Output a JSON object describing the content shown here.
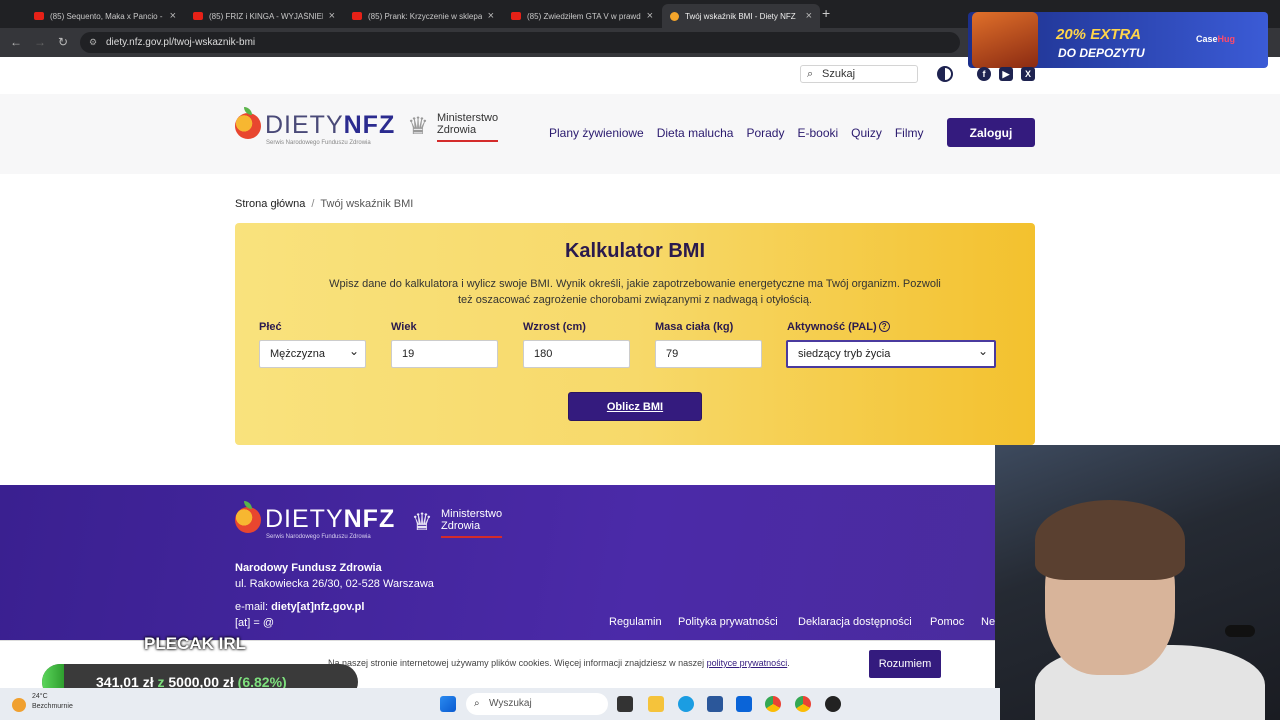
{
  "browser": {
    "tabs": [
      {
        "title": "(85) Sequento, Maka x Pancio -",
        "type": "youtube"
      },
      {
        "title": "(85) FRIZ i KINGA - WYJAŚNIEN",
        "type": "youtube"
      },
      {
        "title": "(85) Prank: Krzyczenie w sklepa",
        "type": "youtube"
      },
      {
        "title": "(85) Zwiedziłem GTA V w prawd",
        "type": "youtube"
      },
      {
        "title": "Twój wskaźnik BMI - Diety NFZ",
        "type": "active"
      }
    ],
    "url": "diety.nfz.gov.pl/twoj-wskaznik-bmi"
  },
  "ad": {
    "line1": "20% EXTRA",
    "line2": "DO DEPOZYTU",
    "brand_a": "Case",
    "brand_b": "Hug"
  },
  "utility": {
    "search_placeholder": "Szukaj"
  },
  "header": {
    "logo_word_a": "DIETY",
    "logo_word_b": "NFZ",
    "logo_sub": "Serwis Narodowego Funduszu Zdrowia",
    "ministry_1": "Ministerstwo",
    "ministry_2": "Zdrowia",
    "nav": [
      "Plany żywieniowe",
      "Dieta malucha",
      "Porady",
      "E-booki",
      "Quizy",
      "Filmy"
    ],
    "login": "Zaloguj"
  },
  "breadcrumb": {
    "home": "Strona główna",
    "sep": "/",
    "current": "Twój wskaźnik BMI"
  },
  "bmi": {
    "title": "Kalkulator BMI",
    "description": "Wpisz dane do kalkulatora i wylicz swoje BMI. Wynik określi, jakie zapotrzebowanie energetyczne ma Twój organizm. Pozwoli też oszacować zagrożenie chorobami związanymi z nadwagą i otyłością.",
    "sex_label": "Płeć",
    "sex_value": "Mężczyzna",
    "age_label": "Wiek",
    "age_value": "19",
    "height_label": "Wzrost (cm)",
    "height_value": "180",
    "weight_label": "Masa ciała (kg)",
    "weight_value": "79",
    "activity_label": "Aktywność (PAL)",
    "activity_value": "siedzący tryb życia",
    "help_glyph": "?",
    "button": "Oblicz BMI"
  },
  "footer": {
    "org": "Narodowy Fundusz Zdrowia",
    "address": "ul. Rakowiecka 26/30, 02-528 Warszawa",
    "email_label": "e-mail:",
    "email": "diety[at]nfz.gov.pl",
    "at_note": "[at] = @",
    "links": [
      "Regulamin",
      "Polityka prywatności",
      "Deklaracja dostępności",
      "Pomoc",
      "Ne"
    ]
  },
  "cookie": {
    "text": "Na naszej stronie internetowej używamy plików cookies. Więcej informacji znajdziesz w naszej ",
    "link": "polityce prywatności",
    "end": ".",
    "button": "Rozumiem"
  },
  "overlay": {
    "title": "PLECAK IRL",
    "goal_current": "341,01 zł",
    "goal_of": "z",
    "goal_target": "5000,00 zł",
    "goal_percent": "(6.82%)",
    "goal_fraction": 0.0682
  },
  "taskbar": {
    "temp": "24°C",
    "weather": "Bezchmurnie",
    "search": "Wyszukaj"
  },
  "colors": {
    "brand_purple": "#341b7e",
    "card_yellow": "#f3c12e",
    "footer": "#4b2aa8"
  }
}
